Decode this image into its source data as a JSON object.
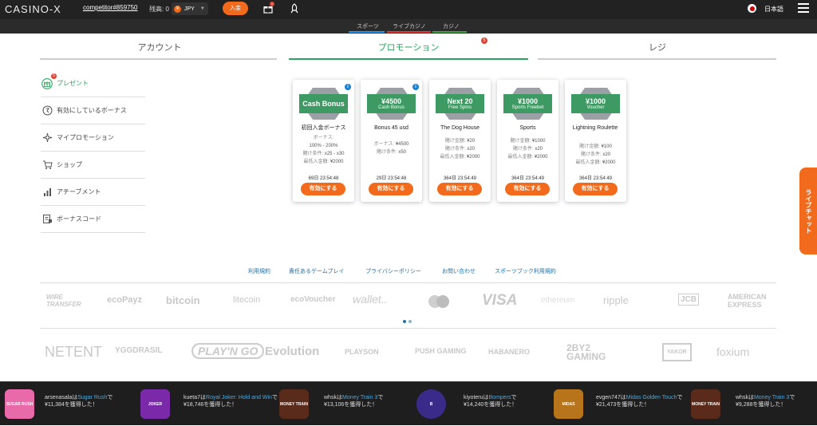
{
  "header": {
    "logo": "CASINO-X",
    "username": "competitor#859750",
    "balance_label": "残高: 0",
    "currency": "JPY",
    "currency_icon": "¥",
    "deposit_label": "入金",
    "gift_badge": "1",
    "language": "日本語"
  },
  "subnav": {
    "items": [
      "スポーツ",
      "ライブカジノ",
      "カジノ"
    ],
    "colors": [
      "#2196f3",
      "#e53935",
      "#43a047"
    ]
  },
  "tabs": {
    "items": [
      "アカウント",
      "プロモーション",
      "レジ"
    ],
    "promo_badge": "5",
    "active_color": "#2aa35e"
  },
  "sidebar": {
    "items": [
      {
        "label": "プレゼント",
        "badge": "5",
        "icon": "gift-icon"
      },
      {
        "label": "有効にしているボーナス",
        "icon": "bonus-icon"
      },
      {
        "label": "マイプロモーション",
        "icon": "sparkle-icon"
      },
      {
        "label": "ショップ",
        "icon": "cart-icon"
      },
      {
        "label": "アチーブメント",
        "icon": "chart-icon"
      },
      {
        "label": "ボーナスコード",
        "icon": "code-icon"
      }
    ]
  },
  "cards": [
    {
      "big": "Cash Bonus",
      "small": "",
      "info": "i",
      "name": "初回入金ボーナス",
      "details": [
        {
          "label": "ボーナス:",
          "value": ""
        },
        {
          "label": "",
          "value": "100% - 200%"
        },
        {
          "label": "賭け条件:",
          "value": "x25 - x30"
        },
        {
          "label": "最低入金額:",
          "value": "¥2000"
        }
      ],
      "time": "69日  23:54:48",
      "button": "有効にする"
    },
    {
      "big": "¥4500",
      "small": "Cash Bonus",
      "info": "i",
      "name": "Bonus 45 usd",
      "details": [
        {
          "label": "ボーナス:",
          "value": "¥4500"
        },
        {
          "label": "賭け条件:",
          "value": "x50"
        }
      ],
      "time": "29日  23:54:48",
      "button": "有効にする"
    },
    {
      "big": "Next 20",
      "small": "Free Spins",
      "info": "",
      "name": "The Dog House",
      "details": [
        {
          "label": "賭け金額:",
          "value": "¥20"
        },
        {
          "label": "賭け条件:",
          "value": "x20"
        },
        {
          "label": "最低入金額:",
          "value": "¥2000"
        }
      ],
      "time": "364日  23:54:49",
      "button": "有効にする"
    },
    {
      "big": "¥1000",
      "small": "Sports Freebet",
      "info": "",
      "name": "Sports",
      "details": [
        {
          "label": "賭け金額:",
          "value": "¥1000"
        },
        {
          "label": "賭け条件:",
          "value": "x20"
        },
        {
          "label": "最低入金額:",
          "value": "¥2000"
        }
      ],
      "time": "364日  23:54:49",
      "button": "有効にする"
    },
    {
      "big": "¥1000",
      "small": "Voucher",
      "info": "",
      "name": "Lightning Roulette",
      "details": [
        {
          "label": "賭け金額:",
          "value": "¥100"
        },
        {
          "label": "賭け条件:",
          "value": "x20"
        },
        {
          "label": "最低入金額:",
          "value": "¥2000"
        }
      ],
      "time": "364日  23:54:49",
      "button": "有効にする"
    }
  ],
  "footer_links": [
    "利用規約",
    "責任あるゲームプレイ",
    "プライバシーポリシー",
    "お問い合わせ",
    "スポーツブック利用規約"
  ],
  "payment_logos": [
    "WIRE TRANSFER",
    "ecoPayz",
    "bitcoin",
    "litecoin",
    "ecoVoucher",
    "wallet..",
    "mastercard",
    "VISA",
    "ethereum",
    "ripple",
    "JCB",
    "AMERICAN EXPRESS"
  ],
  "provider_logos": [
    "NETENT",
    "YGGDRASIL",
    "PLAY'N GO",
    "Evolution",
    "PLAYSON",
    "PUSH GAMING",
    "HABANERO",
    "2BY2 GAMING",
    "YAKOR",
    "foxium"
  ],
  "live_chat": "ライブチャット",
  "ticker": [
    {
      "user": "arsenasala",
      "game": "Sugar Rush",
      "amount": "¥11,384を獲得した！",
      "thumb": "SUGAR RUSH",
      "color": "#e86aa8"
    },
    {
      "user": "kueta7",
      "game": "Royal Joker: Hold and Win",
      "amount": "¥18,746を獲得した！",
      "thumb": "JOKER",
      "color": "#7a2aa8"
    },
    {
      "user": "whsk",
      "game": "Money Train 3",
      "amount": "¥13,106を獲得した！",
      "thumb": "MONEY TRAIN",
      "color": "#5a2a1a"
    },
    {
      "user": "kiyoteru",
      "game": "Bompers",
      "amount": "¥14,240を獲得した！",
      "thumb": "B",
      "color": "#3a2a8a"
    },
    {
      "user": "evgen747",
      "game": "Midas Golden Touch",
      "amount": "¥21,473を獲得した！",
      "thumb": "MIDAS",
      "color": "#b8741a"
    },
    {
      "user": "whsk",
      "game": "Money Train 3",
      "amount": "¥9,288を獲得した！",
      "thumb": "MONEY TRAIN",
      "color": "#5a2a1a"
    }
  ],
  "ticker_join": {
    "ha": "は",
    "de": "で"
  }
}
